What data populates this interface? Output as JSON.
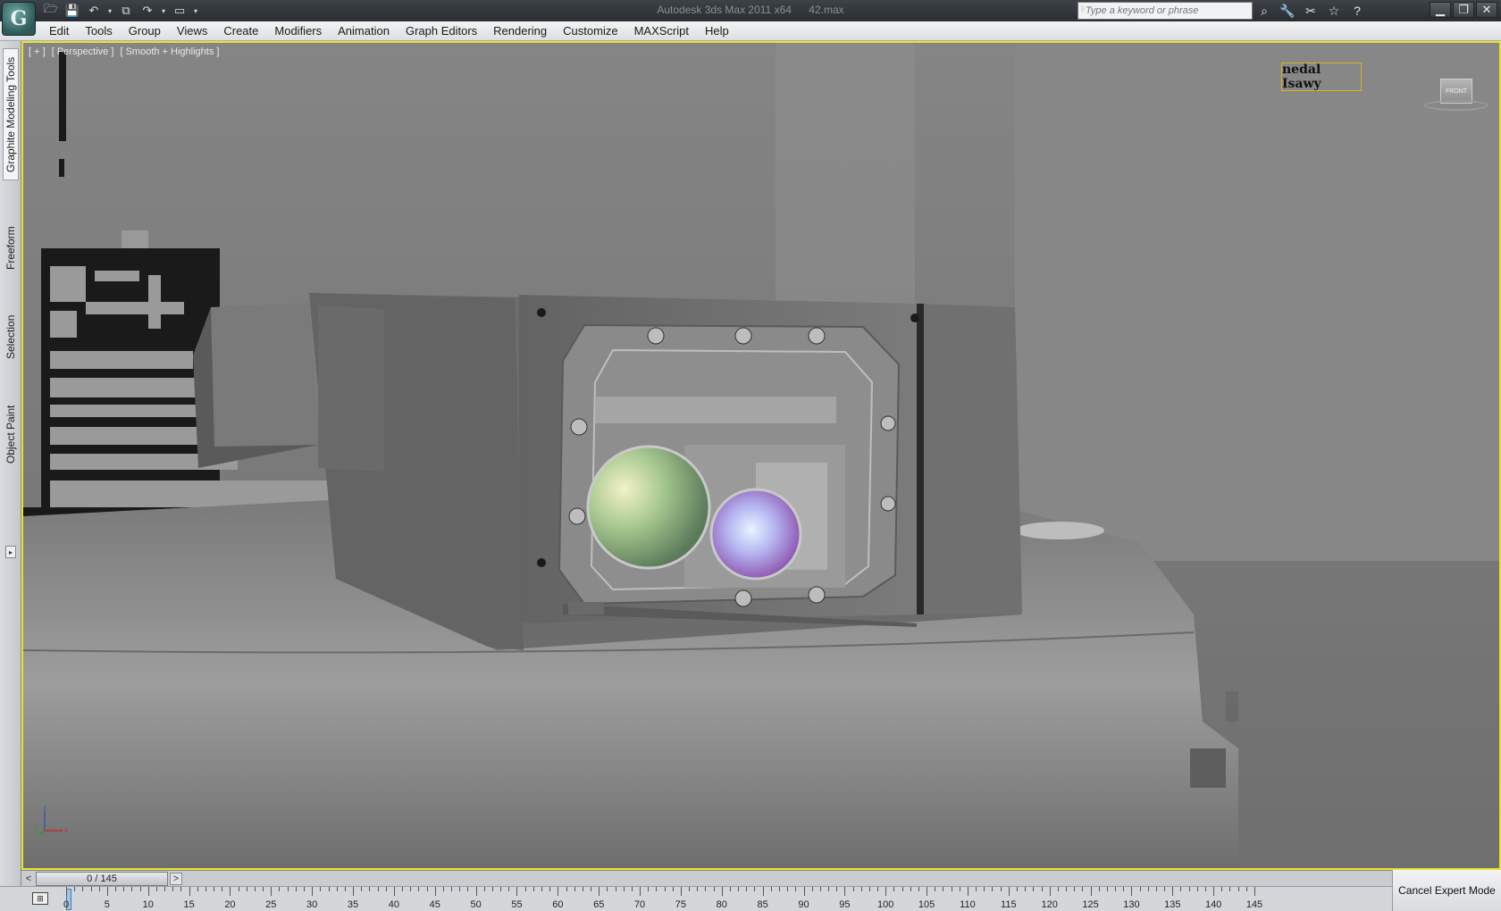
{
  "titlebar": {
    "app_name": "Autodesk 3ds Max  2011 x64",
    "file_name": "42.max",
    "logo_glyph": "G",
    "search_placeholder": "Type a keyword or phrase"
  },
  "quick_access": [
    {
      "name": "open-icon",
      "glyph": "🗁"
    },
    {
      "name": "save-icon",
      "glyph": "💾"
    },
    {
      "name": "undo-icon",
      "glyph": "↶"
    },
    {
      "name": "undo-dropdown-icon",
      "glyph": "▾"
    },
    {
      "name": "hold-icon",
      "glyph": "⧉"
    },
    {
      "name": "redo-icon",
      "glyph": "↷"
    },
    {
      "name": "redo-dropdown-icon",
      "glyph": "▾"
    },
    {
      "name": "project-folder-icon",
      "glyph": "▭"
    },
    {
      "name": "qat-customize-icon",
      "glyph": "▾"
    }
  ],
  "info_icons": [
    {
      "name": "binoculars-icon",
      "glyph": "⌕"
    },
    {
      "name": "subscription-icon",
      "glyph": "🔧"
    },
    {
      "name": "communication-icon",
      "glyph": "✂"
    },
    {
      "name": "favorites-icon",
      "glyph": "☆"
    },
    {
      "name": "help-icon",
      "glyph": "?"
    }
  ],
  "window_controls": {
    "minimize": "▁",
    "restore": "❐",
    "close": "✕"
  },
  "menu": [
    "Edit",
    "Tools",
    "Group",
    "Views",
    "Create",
    "Modifiers",
    "Animation",
    "Graph Editors",
    "Rendering",
    "Customize",
    "MAXScript",
    "Help"
  ],
  "ribbon_tabs": [
    "Graphite Modeling Tools",
    "Freeform",
    "Selection",
    "Object Paint"
  ],
  "ribbon_expand": "▸",
  "viewport": {
    "labels": [
      "[ + ]",
      "[ Perspective ]",
      "[ Smooth + Highlights ]"
    ],
    "watermark": "nedal Isawy",
    "viewcube_face": "FRONT",
    "axis": {
      "z": "z",
      "y": "y",
      "x": "x"
    }
  },
  "colors": {
    "active_border": "#e8e32a",
    "watermark_border": "#d8b424"
  },
  "timeline": {
    "prev": "<",
    "next": ">",
    "position": "0 / 145",
    "ticks": [
      "0",
      "5",
      "10",
      "15",
      "20",
      "25",
      "30",
      "35",
      "40",
      "45",
      "50",
      "55",
      "60",
      "65",
      "70",
      "75",
      "80",
      "85",
      "90",
      "95",
      "100",
      "105",
      "110",
      "115",
      "120",
      "125",
      "130",
      "135",
      "140",
      "145"
    ],
    "track_icon": "⊞"
  },
  "expert_mode_button": "Cancel Expert Mode"
}
